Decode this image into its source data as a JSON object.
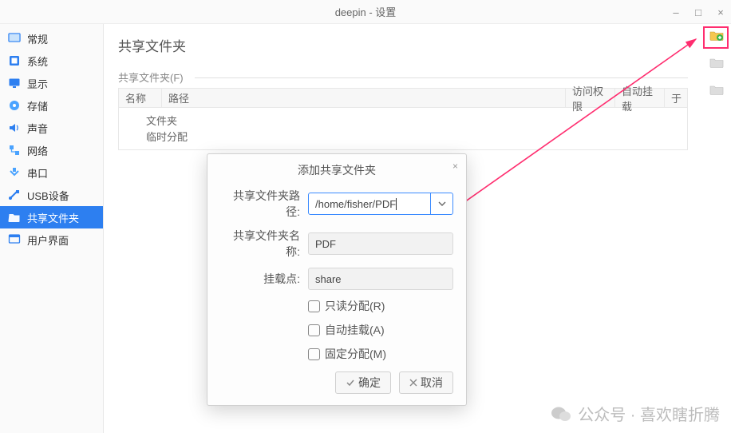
{
  "window": {
    "title": "deepin - 设置"
  },
  "sidebar": {
    "items": [
      {
        "label": "常规"
      },
      {
        "label": "系统"
      },
      {
        "label": "显示"
      },
      {
        "label": "存储"
      },
      {
        "label": "声音"
      },
      {
        "label": "网络"
      },
      {
        "label": "串口"
      },
      {
        "label": "USB设备"
      },
      {
        "label": "共享文件夹"
      },
      {
        "label": "用户界面"
      }
    ]
  },
  "content": {
    "heading": "共享文件夹",
    "subheading": "共享文件夹(F)",
    "columns": {
      "name": "名称",
      "path": "路径",
      "access": "访问权限",
      "automount": "自动挂载",
      "at": "于"
    },
    "rows": [
      {
        "label": "文件夹"
      },
      {
        "label": "临时分配"
      }
    ]
  },
  "dialog": {
    "title": "添加共享文件夹",
    "path_label": "共享文件夹路径:",
    "path_value": "/home/fisher/PDF",
    "name_label": "共享文件夹名称:",
    "name_value": "PDF",
    "mount_label": "挂载点:",
    "mount_value": "share",
    "readonly_label": "只读分配(R)",
    "automount_label": "自动挂载(A)",
    "permanent_label": "固定分配(M)",
    "ok": "确定",
    "cancel": "取消"
  },
  "watermark": {
    "text": "公众号 · 喜欢瞎折腾"
  }
}
